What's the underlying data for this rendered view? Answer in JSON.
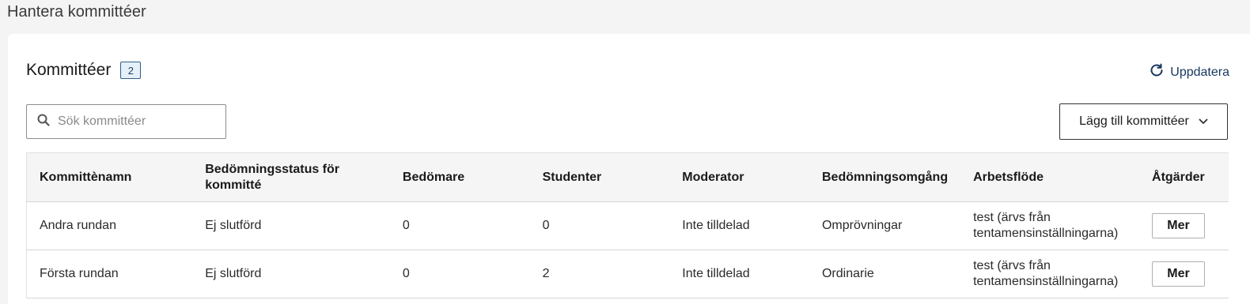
{
  "page": {
    "title": "Hantera kommittéer"
  },
  "panel": {
    "title": "Kommittéer",
    "count": "2",
    "refresh_label": "Uppdatera"
  },
  "search": {
    "placeholder": "Sök kommittéer",
    "value": ""
  },
  "add_button": {
    "label": "Lägg till kommittéer"
  },
  "table": {
    "columns": [
      "Kommittènamn",
      "Bedömningsstatus för kommitté",
      "Bedömare",
      "Studenter",
      "Moderator",
      "Bedömningsomgång",
      "Arbetsflöde",
      "Åtgärder"
    ],
    "rows": [
      {
        "name": "Andra rundan",
        "status": "Ej slutförd",
        "graders": "0",
        "students": "0",
        "moderator": "Inte tilldelad",
        "round": "Omprövningar",
        "workflow": "test (ärvs från tentamensinställningarna)",
        "action": "Mer"
      },
      {
        "name": "Första rundan",
        "status": "Ej slutförd",
        "graders": "0",
        "students": "2",
        "moderator": "Inte tilldelad",
        "round": "Ordinarie",
        "workflow": "test (ärvs från tentamensinställningarna)",
        "action": "Mer"
      }
    ]
  },
  "icons": {
    "search": "search-icon",
    "refresh": "refresh-icon",
    "chevron": "chevron-down-icon"
  },
  "colors": {
    "accent": "#17375e",
    "badge_border": "#2f5f8a",
    "badge_bg": "#e6f0f8"
  }
}
